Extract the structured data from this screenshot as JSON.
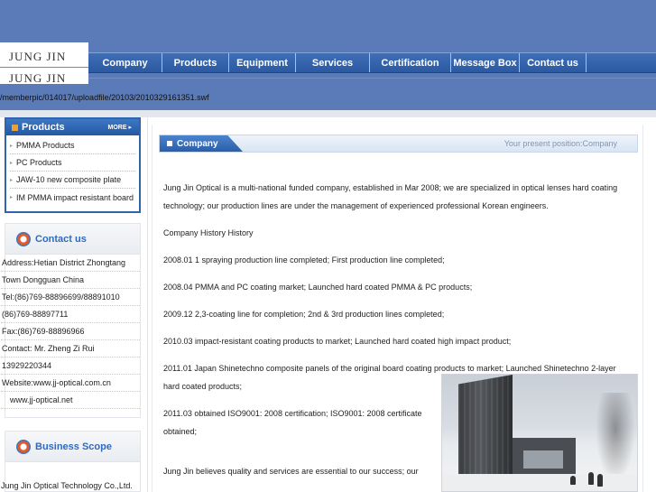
{
  "logo": {
    "line1": "JUNG JIN",
    "line2": "JUNG JIN"
  },
  "nav": {
    "items": [
      {
        "label": "Company"
      },
      {
        "label": "Products"
      },
      {
        "label": "Equipment"
      },
      {
        "label": "Services"
      },
      {
        "label": "Certification"
      },
      {
        "label": "Message Box"
      },
      {
        "label": "Contact us"
      }
    ]
  },
  "swf_path": "/memberpic/014017/uploadfile/20103/2010329161351.swf",
  "products_panel": {
    "title": "Products",
    "more": "MORE",
    "items": [
      {
        "label": "PMMA Products"
      },
      {
        "label": "PC Products"
      },
      {
        "label": "JAW-10 new composite plate"
      },
      {
        "label": "IM PMMA impact resistant board"
      }
    ]
  },
  "contact_panel": {
    "title": "Contact us",
    "lines": [
      {
        "text": "Address:Hetian District Zhongtang"
      },
      {
        "text": "Town Dongguan China"
      },
      {
        "text": "Tel:(86)769-88896699/88891010"
      },
      {
        "text": "(86)769-88897711"
      },
      {
        "text": "Fax:(86)769-88896966"
      },
      {
        "text": "Contact: Mr. Zheng Zi Rui"
      },
      {
        "text": "13929220344"
      },
      {
        "text": "Website:www.jj-optical.com.cn"
      },
      {
        "text": "www.jj-optical.net"
      }
    ]
  },
  "scope_panel": {
    "title": "Business Scope",
    "text": "Jung Jin Optical Technology Co.,Ltd."
  },
  "main": {
    "section_title": "Company",
    "position_text": "Your present position:Company",
    "paragraphs": [
      {
        "text": "Jung Jin Optical is a multi-national funded company, established in Mar 2008; we are specialized in optical lenses hard coating technology; our production lines are under the management of experienced professional Korean engineers."
      },
      {
        "text": "Company History History"
      },
      {
        "text": "2008.01 1 spraying production line completed; First production line completed;"
      },
      {
        "text": "2008.04 PMMA and PC coating market; Launched hard coated PMMA & PC products;"
      },
      {
        "text": "2009.12 2,3-coating line for completion; 2nd & 3rd production lines completed;"
      },
      {
        "text": "2010.03 impact-resistant coating products to market; Launched hard coated high impact product;"
      },
      {
        "text": "2011.01 Japan Shinetechno composite panels of the original board coating products to market; Launched Shinetechno 2-layer hard coated products;"
      },
      {
        "text": "2011.03 obtained ISO9001: 2008 certification; ISO9001: 2008 certificate obtained;"
      },
      {
        "text": "Jung Jin believes quality and services are essential to our success; our"
      }
    ]
  },
  "colors": {
    "header_bg": "#5a7bb8",
    "nav_bg": "#2b5aa3",
    "accent": "#2e6bbf",
    "position_text": "#7d96b8"
  }
}
